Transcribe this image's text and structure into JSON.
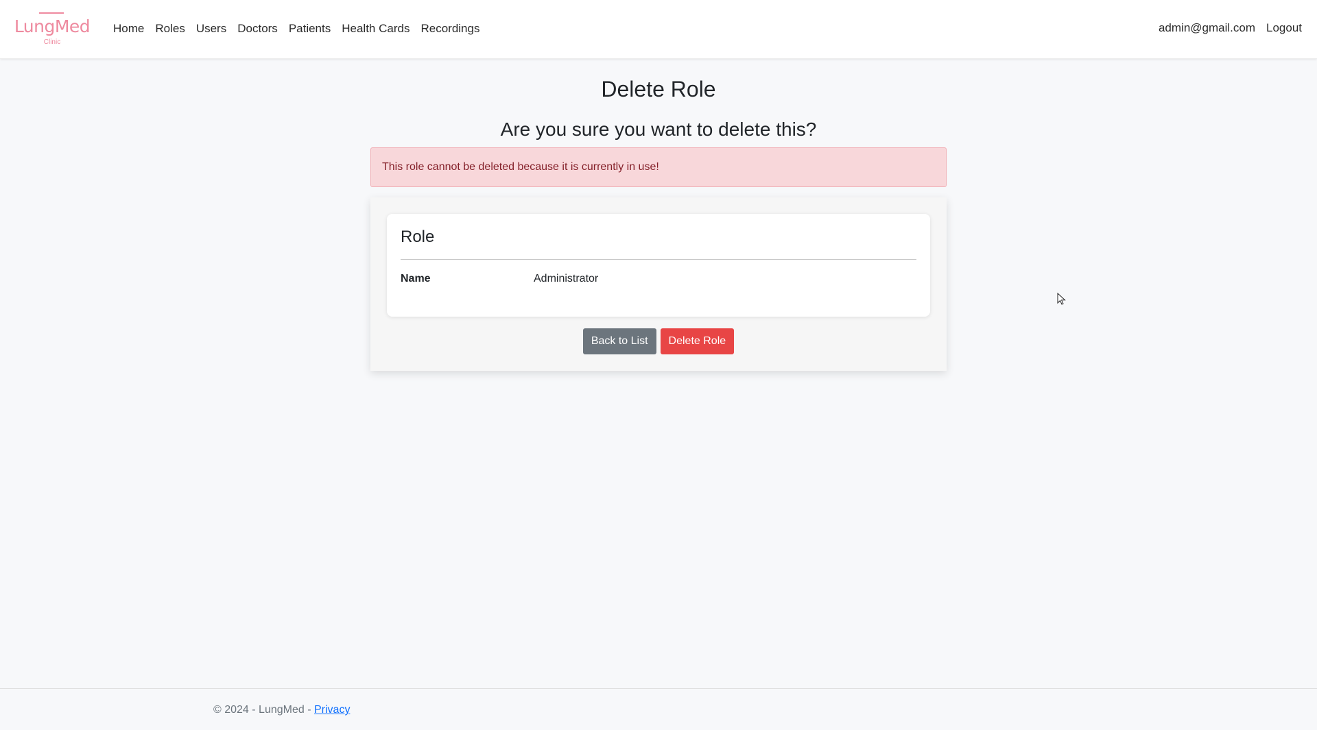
{
  "brand": {
    "name": "LungMed",
    "subtitle": "Clinic",
    "color": "#ee8a9f"
  },
  "nav": {
    "items": [
      {
        "label": "Home"
      },
      {
        "label": "Roles"
      },
      {
        "label": "Users"
      },
      {
        "label": "Doctors"
      },
      {
        "label": "Patients"
      },
      {
        "label": "Health Cards"
      },
      {
        "label": "Recordings"
      }
    ],
    "user_email": "admin@gmail.com",
    "logout_label": "Logout"
  },
  "page": {
    "title": "Delete Role",
    "confirm_question": "Are you sure you want to delete this?",
    "alert_message": "This role cannot be deleted because it is currently in use!"
  },
  "card": {
    "title": "Role",
    "fields": [
      {
        "label": "Name",
        "value": "Administrator"
      }
    ]
  },
  "actions": {
    "back_label": "Back to List",
    "delete_label": "Delete Role",
    "back_color": "#6c757d",
    "delete_color": "#e84545"
  },
  "footer": {
    "copyright": "© 2024 - LungMed - ",
    "privacy_label": "Privacy"
  }
}
